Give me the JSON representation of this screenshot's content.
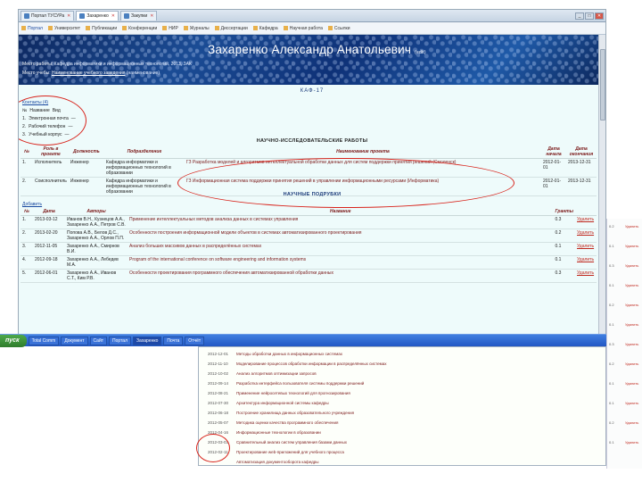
{
  "browser": {
    "tabs": [
      {
        "label": "Портал ТУСУРа",
        "active": false
      },
      {
        "label": "Захаренко",
        "active": true
      },
      {
        "label": "Закупки",
        "active": false
      }
    ],
    "bookmarks": [
      "Портал",
      "Университет",
      "Публикации",
      "Конференции",
      "НИР",
      "Журналы",
      "Диссертации",
      "Кафедра",
      "Научная работа",
      "Ссылки"
    ]
  },
  "header": {
    "name": "Захаренко Александр Анатольевич",
    "badge": "(edit)",
    "line1_label": "Место работы:",
    "line1_value": "Кафедра информатики и информационных технологий, 2013, ЗАК",
    "line2_label": "Место учебы:",
    "line2_value": "Наименование учебного заведения",
    "line2_extra": "(наименование)"
  },
  "kafedra_label": "КАФ-17",
  "left_list": {
    "title": "Контакты (4)",
    "rows": [
      {
        "num": "№",
        "label": "Название",
        "val": "Вид"
      },
      {
        "num": "1.",
        "label": "Электронная почта",
        "val": "—"
      },
      {
        "num": "2.",
        "label": "Рабочий телефон",
        "val": "—"
      },
      {
        "num": "3.",
        "label": "Учебный корпус",
        "val": "—"
      }
    ]
  },
  "research": {
    "title": "НАУЧНО-ИССЛЕДОВАТЕЛЬСКИЕ РАБОТЫ",
    "columns": [
      "№",
      "Роль в проекте",
      "Должность",
      "Подразделение",
      "Наименование проекта",
      "Дата начала",
      "Дата окончания"
    ],
    "rows": [
      {
        "num": "1.",
        "role": "Исполнитель",
        "pos": "Инженер",
        "dept": "Кафедра информатики и информационных технологий в образовании",
        "project": "ГЗ Разработка моделей и алгоритмов интеллектуальной обработки данных для систем поддержки принятия решений (Смоленск)",
        "start": "2012-01-01",
        "end": "2013-12-31"
      },
      {
        "num": "2.",
        "role": "Соисполнитель",
        "pos": "Инженер",
        "dept": "Кафедра информатики и информационных технологий в образовании",
        "project": "ГЗ Информационная система поддержки принятия решений в управлении информационными ресурсами (Информатика)",
        "start": "2012-01-01",
        "end": "2013-12-31"
      }
    ]
  },
  "publications": {
    "title": "НАУЧНЫЕ ПОДРУБКИ",
    "add_link": "Добавить",
    "columns": [
      "№",
      "Дата",
      "Авторы",
      "Название",
      "Гранты",
      ""
    ],
    "rows": [
      {
        "num": "1.",
        "date": "2013-03-12",
        "authors": "Иванов В.Н., Кузнецов А.А., Захаренко А.А., Петров С.В.",
        "title": "Применение интеллектуальных методов анализа данных в системах управления",
        "grant": "0.3",
        "action": "Удалить"
      },
      {
        "num": "2.",
        "date": "2013-02-20",
        "authors": "Попова А.В., Белов Д.С., Захаренко А.А., Орлов П.П.",
        "title": "Особенности построения информационной модели объектов в системах автоматизированного проектирования",
        "grant": "0.2",
        "action": "Удалить"
      },
      {
        "num": "3.",
        "date": "2012-11-05",
        "authors": "Захаренко А.А., Смирнов В.И.",
        "title": "Анализ больших массивов данных в распределённых системах",
        "grant": "0.1",
        "action": "Удалить"
      },
      {
        "num": "4.",
        "date": "2012-09-18",
        "authors": "Захаренко А.А., Лебедев М.А.",
        "title": "Program of the international conference on software engineering and information systems",
        "grant": "0.1",
        "action": "Удалить"
      },
      {
        "num": "5.",
        "date": "2012-06-01",
        "authors": "Захаренко А.А., Иванов С.Т., Ким Р.В.",
        "title": "Особенности проектирования программного обеспечения автоматизированной обработки данных",
        "grant": "0.3",
        "action": "Удалить"
      }
    ]
  },
  "taskbar": {
    "start": "пуск",
    "tasks": [
      "Total Comm",
      "Документ",
      "Сайт",
      "Портал",
      "Захаренко",
      "Почта",
      "Отчёт"
    ]
  },
  "secondary_rows": [
    {
      "date": "2012-12-01",
      "title": "Методы обработки данных в информационных системах"
    },
    {
      "date": "2012-11-10",
      "title": "Моделирование процессов обработки информации в распределённых системах"
    },
    {
      "date": "2012-10-02",
      "title": "Анализ алгоритмов оптимизации запросов"
    },
    {
      "date": "2012-09-14",
      "title": "Разработка интерфейса пользователя системы поддержки решений"
    },
    {
      "date": "2012-08-21",
      "title": "Применение нейросетевых технологий для прогнозирования"
    },
    {
      "date": "2012-07-30",
      "title": "Архитектура информационной системы кафедры"
    },
    {
      "date": "2012-06-18",
      "title": "Построение хранилища данных образовательного учреждения"
    },
    {
      "date": "2012-05-07",
      "title": "Методика оценки качества программного обеспечения"
    },
    {
      "date": "2012-04-16",
      "title": "Информационные технологии в образовании"
    },
    {
      "date": "2012-03-03",
      "title": "Сравнительный анализ систем управления базами данных"
    },
    {
      "date": "2012-02-11",
      "title": "Проектирование web-приложений для учебного процесса"
    },
    {
      "date": "",
      "title": "Автоматизация документооборота кафедры"
    }
  ],
  "strip_rows": [
    {
      "v": "0.2",
      "a": "Удалить"
    },
    {
      "v": "0.1",
      "a": "Удалить"
    },
    {
      "v": "0.3",
      "a": "Удалить"
    },
    {
      "v": "0.1",
      "a": "Удалить"
    },
    {
      "v": "0.2",
      "a": "Удалить"
    },
    {
      "v": "0.1",
      "a": "Удалить"
    },
    {
      "v": "0.3",
      "a": "Удалить"
    },
    {
      "v": "0.2",
      "a": "Удалить"
    },
    {
      "v": "0.1",
      "a": "Удалить"
    },
    {
      "v": "0.1",
      "a": "Удалить"
    },
    {
      "v": "0.2",
      "a": "Удалить"
    },
    {
      "v": "0.1",
      "a": "Удалить"
    }
  ]
}
